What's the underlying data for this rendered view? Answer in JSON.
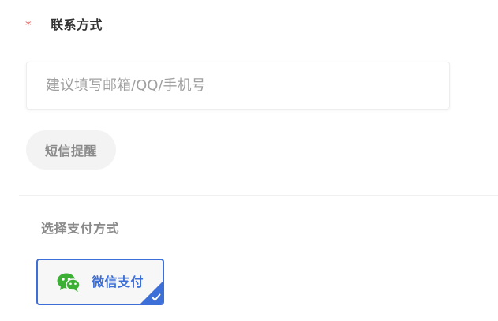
{
  "contact": {
    "required_mark": "*",
    "label": "联系方式",
    "input_placeholder": "建议填写邮箱/QQ/手机号",
    "input_value": "",
    "sms_button_label": "短信提醒"
  },
  "payment": {
    "section_title": "选择支付方式",
    "methods": [
      {
        "label": "微信支付",
        "icon": "wechat-icon",
        "selected": true
      }
    ]
  },
  "colors": {
    "required": "#e85a5a",
    "accent": "#3d6fd9",
    "wechat_green": "#3cb034"
  }
}
